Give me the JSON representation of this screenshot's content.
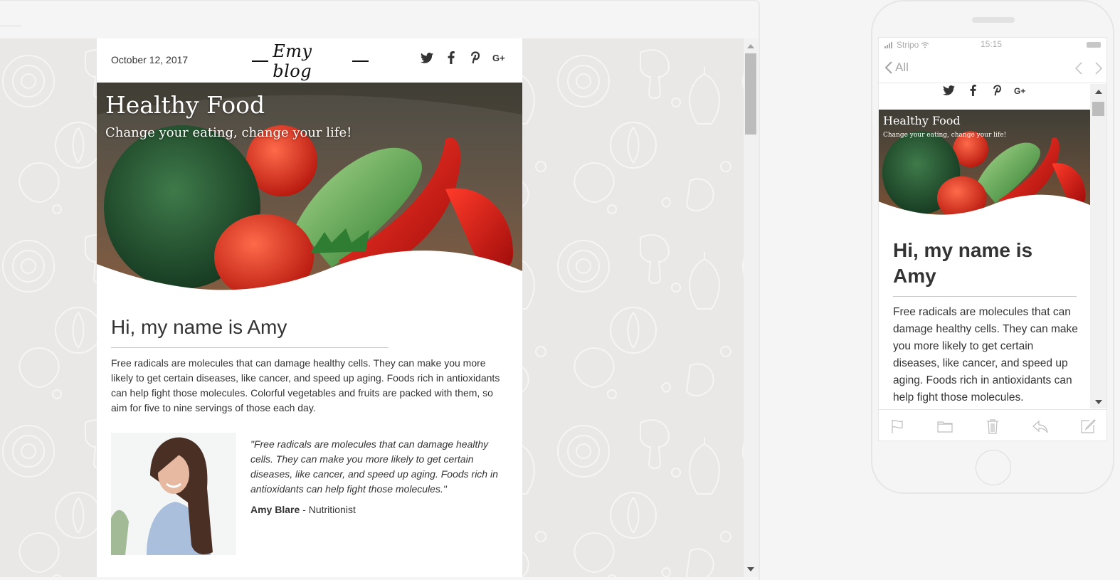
{
  "desktop": {
    "email": {
      "date": "October 12, 2017",
      "logo": "Emy blog",
      "social_icons": [
        "twitter-icon",
        "facebook-icon",
        "pinterest-icon",
        "google-plus-icon"
      ],
      "hero": {
        "title": "Healthy Food",
        "subtitle": "Change your eating, change your life!"
      },
      "greeting": "Hi, my name is Amy",
      "paragraph": "Free radicals are molecules that can damage healthy cells. They can make you more likely to get certain diseases, like cancer, and speed up aging. Foods rich in antioxidants can help fight those molecules. Colorful vegetables and fruits are packed with them, so aim for five to nine servings of those each day.",
      "quote": {
        "text": "\"Free radicals are molecules that can damage healthy cells. They can make you more likely to get certain diseases, like cancer, and speed up aging. Foods rich in antioxidants can help fight those molecules.\"",
        "author_name": "Amy Blare",
        "author_role": " - Nutritionist"
      }
    }
  },
  "mobile": {
    "status": {
      "carrier": "Stripo",
      "time": "15:15"
    },
    "nav": {
      "back_label": "All"
    },
    "email": {
      "hero_title": "Healthy Food",
      "hero_subtitle": "Change your eating, change your life!",
      "greeting": "Hi, my name is Amy",
      "paragraph": "Free radicals are molecules that can damage healthy cells. They can make you more likely to get certain diseases, like cancer, and speed up aging. Foods rich in antioxidants can help fight those molecules."
    },
    "toolbar_icons": [
      "flag-icon",
      "folder-icon",
      "trash-icon",
      "reply-icon",
      "compose-icon"
    ]
  },
  "colors": {
    "canvas_bg": "#e9e8e6",
    "text": "#333333",
    "muted_icon": "#a8a8a8"
  }
}
